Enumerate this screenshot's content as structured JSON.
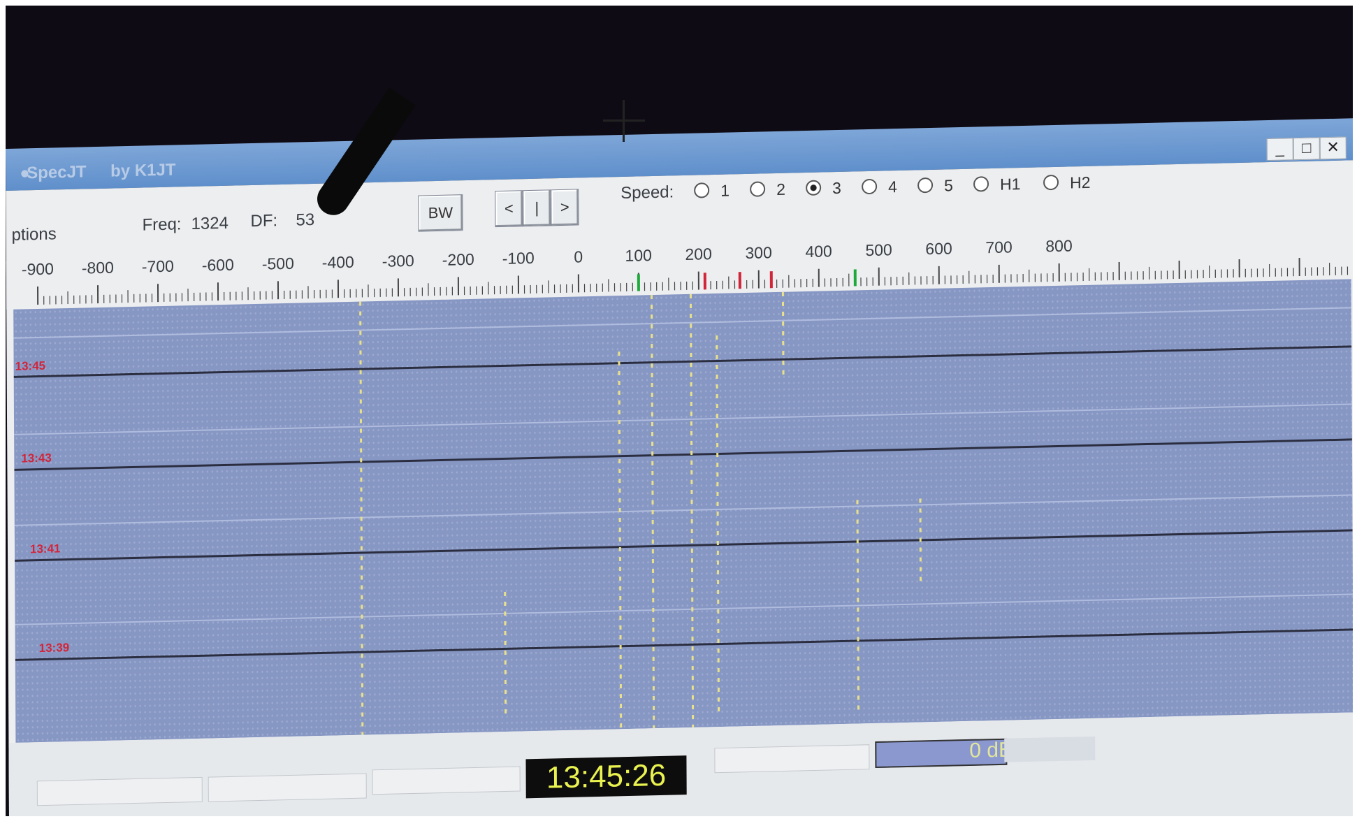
{
  "app": {
    "title": "SpecJT",
    "byline": "by K1JT"
  },
  "window_controls": {
    "minimize": "_",
    "maximize": "□",
    "close": "✕"
  },
  "menu": {
    "options_label": "ptions"
  },
  "readout": {
    "freq_label": "Freq:",
    "freq_value": "1324",
    "df_label": "DF:",
    "df_value": "53"
  },
  "buttons": {
    "bw": "BW",
    "prev": "<",
    "mid": "|",
    "next": ">"
  },
  "speed": {
    "label": "Speed:",
    "options": [
      "1",
      "2",
      "3",
      "4",
      "5",
      "H1",
      "H2"
    ],
    "selected": "3"
  },
  "scale_labels": [
    "-900",
    "-800",
    "-700",
    "-600",
    "-500",
    "-400",
    "-300",
    "-200",
    "-100",
    "0",
    "100",
    "200",
    "300",
    "400",
    "500",
    "600",
    "700",
    "800"
  ],
  "waterfall_times": [
    "13:45",
    "13:43",
    "13:41",
    "13:39"
  ],
  "clock": "13:45:26",
  "level_meter": {
    "value_text": "0 dB"
  },
  "colors": {
    "waterfall": "#8797c4",
    "trace": "#e8e08a",
    "time_label": "#d1253a",
    "clock_text": "#e9f24f"
  }
}
